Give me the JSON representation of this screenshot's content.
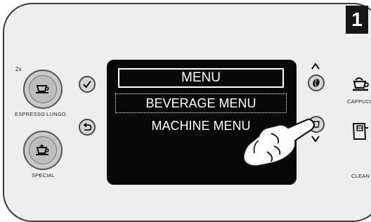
{
  "step": {
    "number": "1"
  },
  "left_buttons": {
    "espresso_lungo": {
      "label": "ESPRESSO LUNGO",
      "badge": "2x",
      "icon": "cup-icon"
    },
    "special": {
      "label": "SPECIAL",
      "icon": "cup-star-icon"
    }
  },
  "middle_buttons": {
    "ok": {
      "icon": "checkmark-icon"
    },
    "back": {
      "icon": "back-arrow-icon"
    }
  },
  "display": {
    "title": "MENU",
    "items": [
      "BEVERAGE MENU",
      "MACHINE MENU"
    ],
    "selected_index": 0
  },
  "right_controls": {
    "up": {
      "icon": "chevron-up-icon"
    },
    "bean": {
      "icon": "coffee-bean-icon"
    },
    "cup_size": {
      "icon": "cup-size-icon"
    },
    "down": {
      "icon": "chevron-down-icon"
    }
  },
  "right_buttons": {
    "cappuccino": {
      "label": "CAPPUCCI",
      "icon": "cappuccino-cup-icon"
    },
    "clean": {
      "label": "CLEAN",
      "icon": "clean-icon"
    }
  },
  "hand": {
    "icon": "pointing-hand-icon"
  },
  "colors": {
    "panel": "#eeeeee",
    "screen": "#080808",
    "text": "#ffffff"
  }
}
